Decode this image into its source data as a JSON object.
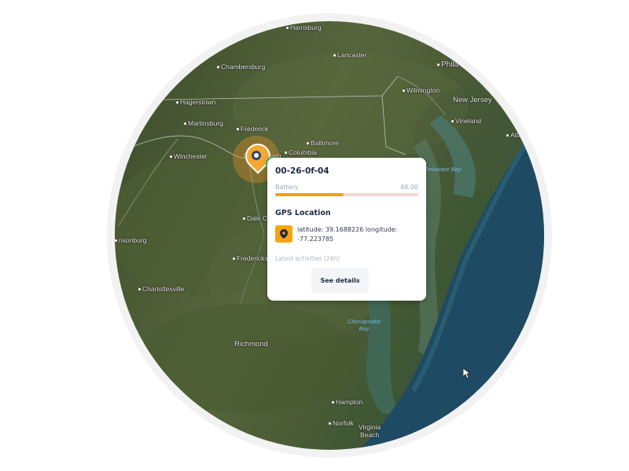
{
  "map": {
    "cities": [
      {
        "id": "harrisburg",
        "label": "Harrisburg"
      },
      {
        "id": "lancaster",
        "label": "Lancaster"
      },
      {
        "id": "chambersburg",
        "label": "Chambersburg"
      },
      {
        "id": "philadelphia",
        "label": "Phila"
      },
      {
        "id": "wilmington",
        "label": "Wilmington"
      },
      {
        "id": "new-jersey",
        "label": "New Jersey"
      },
      {
        "id": "hagerstown",
        "label": "Hagerstown"
      },
      {
        "id": "martinsburg",
        "label": "Martinsburg"
      },
      {
        "id": "frederick",
        "label": "Frederick"
      },
      {
        "id": "baltimore",
        "label": "Baltimore"
      },
      {
        "id": "vineland",
        "label": "Vineland"
      },
      {
        "id": "winchester",
        "label": "Winchester"
      },
      {
        "id": "germantown",
        "label": "Germantown"
      },
      {
        "id": "columbia",
        "label": "Columbia"
      },
      {
        "id": "atlantic",
        "label": "Atla"
      },
      {
        "id": "dale-city",
        "label": "Dale City"
      },
      {
        "id": "harrisonburg",
        "label": "risonburg"
      },
      {
        "id": "fredericksburg",
        "label": "Fredericksburg"
      },
      {
        "id": "charlottesville",
        "label": "Charlottesville"
      },
      {
        "id": "richmond",
        "label": "Richmond"
      },
      {
        "id": "hampton",
        "label": "Hampton"
      },
      {
        "id": "norfolk",
        "label": "Norfolk"
      },
      {
        "id": "virginia-beach",
        "label": "Virginia\nBeach"
      }
    ],
    "water_labels": [
      {
        "id": "delaware-bay",
        "label": "Delaware Bay"
      },
      {
        "id": "chesapeake-bay",
        "label": "Chesapeake\nBay"
      }
    ]
  },
  "popup": {
    "device_id": "00-26-0f-04",
    "battery_label": "Battery",
    "battery_value": "48.00",
    "battery_fraction": 0.48,
    "gps_title": "GPS Location",
    "gps_text": "latitude: 39.1688226 longitude: -77.223785",
    "latest_label": "Latest activities (24h)",
    "details_button": "See details"
  },
  "colors": {
    "accent": "#f6a40f",
    "battery_track": "#f6d9d2",
    "text_dark": "#1f2a44",
    "marker_green": "#3fae6a"
  },
  "icons": {
    "marker": "location-pin-icon",
    "gps": "map-pin-icon",
    "cursor": "mouse-cursor-icon"
  }
}
